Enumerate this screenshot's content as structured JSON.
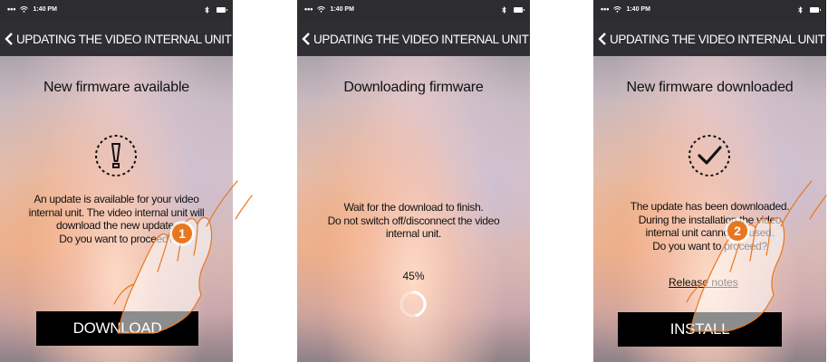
{
  "status_bar": {
    "time": "1:40 PM"
  },
  "nav": {
    "title": "UPDATING THE VIDEO INTERNAL UNIT"
  },
  "screens": [
    {
      "title": "New firmware available",
      "icon": "exclamation-icon",
      "message": [
        "An update is available for your video",
        "internal unit. The video internal unit will",
        "download the new update.",
        "Do you want to proceed?"
      ],
      "button_label": "DOWNLOAD",
      "step": "1"
    },
    {
      "title": "Downloading firmware",
      "message": [
        "Wait for the download to finish.",
        "Do not switch off/disconnect the video",
        "internal unit."
      ],
      "progress_text": "45%",
      "progress_value": 45
    },
    {
      "title": "New firmware downloaded",
      "icon": "checkmark-icon",
      "message": [
        "The update has been downloaded.",
        "During the installation the video",
        "internal unit cannot be used.",
        "Do you want to proceed?"
      ],
      "link_label": "Release notes",
      "button_label": "INSTALL",
      "step": "2"
    }
  ],
  "colors": {
    "nav_bg": "#2f2f33",
    "button_bg": "#000000",
    "badge": "#e8761e",
    "hand_outline": "#e8761e"
  }
}
